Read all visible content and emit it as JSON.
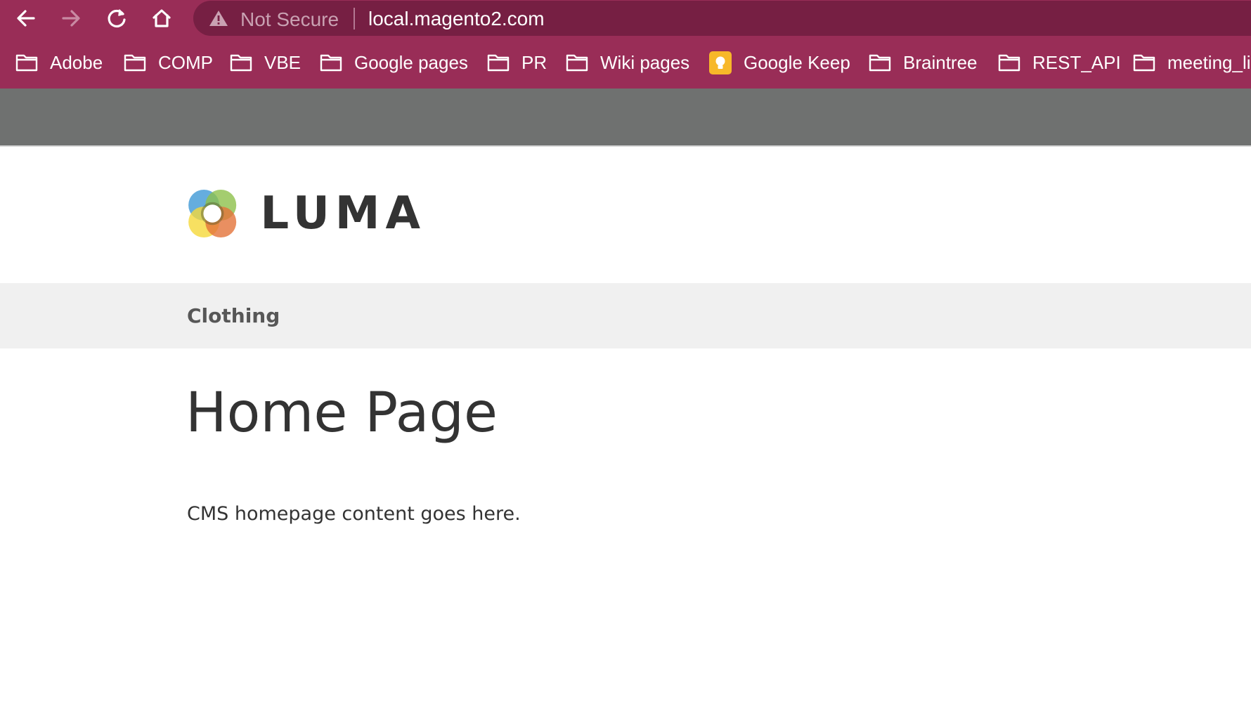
{
  "browser": {
    "omnibox": {
      "security_text": "Not Secure",
      "url": "local.magento2.com"
    },
    "colors": {
      "toolbar": "#992d57",
      "omnibox": "#761f43"
    },
    "nav_icons": [
      "back-arrow-icon",
      "forward-arrow-icon",
      "reload-icon",
      "home-icon"
    ],
    "bookmarks": [
      {
        "label": "Adobe",
        "icon": "folder-icon"
      },
      {
        "label": "COMP",
        "icon": "folder-icon"
      },
      {
        "label": "VBE",
        "icon": "folder-icon"
      },
      {
        "label": "Google pages",
        "icon": "folder-icon"
      },
      {
        "label": "PR",
        "icon": "folder-icon"
      },
      {
        "label": "Wiki pages",
        "icon": "folder-icon"
      },
      {
        "label": "Google Keep",
        "icon": "google-keep-icon"
      },
      {
        "label": "Braintree",
        "icon": "folder-icon"
      },
      {
        "label": "REST_API",
        "icon": "folder-icon"
      },
      {
        "label": "meeting_li",
        "icon": "folder-icon"
      }
    ]
  },
  "store": {
    "logo_text": "LUMA",
    "nav": {
      "items": [
        "Clothing"
      ]
    },
    "page_title": "Home Page",
    "content": "CMS homepage content goes here."
  }
}
